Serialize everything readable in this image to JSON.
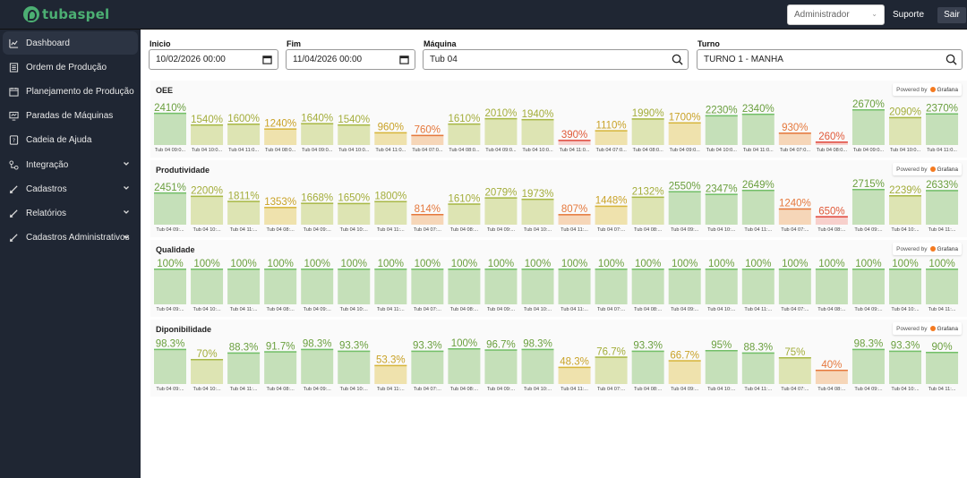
{
  "header": {
    "logo_text": "tubaspel",
    "role_value": "Administrador",
    "support_label": "Suporte",
    "logout_label": "Sair"
  },
  "sidebar": {
    "items": [
      {
        "label": "Dashboard",
        "icon": "chart-line-icon",
        "active": true,
        "expandable": false
      },
      {
        "label": "Ordem de Produção",
        "icon": "document-list-icon",
        "active": false,
        "expandable": false
      },
      {
        "label": "Planejamento de Produção",
        "icon": "calendar-icon",
        "active": false,
        "expandable": false
      },
      {
        "label": "Paradas de Máquinas",
        "icon": "monitor-icon",
        "active": false,
        "expandable": false
      },
      {
        "label": "Cadeia de Ajuda",
        "icon": "help-doc-icon",
        "active": false,
        "expandable": false
      },
      {
        "label": "Integração",
        "icon": "integration-icon",
        "active": false,
        "expandable": true
      },
      {
        "label": "Cadastros",
        "icon": "pencil-icon",
        "active": false,
        "expandable": true
      },
      {
        "label": "Relatórios",
        "icon": "pencil-icon",
        "active": false,
        "expandable": true
      },
      {
        "label": "Cadastros Administrativos",
        "icon": "pencil-icon",
        "active": false,
        "expandable": true
      }
    ]
  },
  "filters": {
    "start": {
      "label": "Inicio",
      "value": "10/02/2026 00:00"
    },
    "end": {
      "label": "Fim",
      "value": "11/04/2026 00:00"
    },
    "machine": {
      "label": "Máquina",
      "value": "Tub 04"
    },
    "shift": {
      "label": "Turno",
      "value": "TURNO 1 - MANHA"
    }
  },
  "powered_by": {
    "prefix": "Powered by",
    "brand": "Grafana"
  },
  "colors": {
    "green_fill": "#c5e0b9",
    "green_line": "#73bf69",
    "green_text": "#6a9f3e",
    "yellowgreen_fill": "#dde4b3",
    "yellowgreen_line": "#a8b846",
    "yellowgreen_text": "#a3ad3a",
    "yellow_fill": "#efe2ad",
    "yellow_line": "#d7b53c",
    "yellow_text": "#c9a227",
    "orange_fill": "#f6d6b8",
    "orange_line": "#e5783c",
    "orange_text": "#e5783c",
    "red_fill": "#f7d0cc",
    "red_line": "#e0463a",
    "red_text": "#e05a3a"
  },
  "chart_data": [
    {
      "type": "bar",
      "title": "OEE",
      "categories": [
        "Tub 04 09:0...",
        "Tub 04 10:0...",
        "Tub 04 11:0...",
        "Tub 04 08:0...",
        "Tub 04 09:0...",
        "Tub 04 10:0...",
        "Tub 04 11:0...",
        "Tub 04 07:0...",
        "Tub 04 08:0...",
        "Tub 04 09:0...",
        "Tub 04 10:0...",
        "Tub 04 11:0...",
        "Tub 04 07:0...",
        "Tub 04 08:0...",
        "Tub 04 09:0...",
        "Tub 04 10:0...",
        "Tub 04 11:0...",
        "Tub 04 07:0...",
        "Tub 04 08:0...",
        "Tub 04 09:0...",
        "Tub 04 10:0...",
        "Tub 04 11:0..."
      ],
      "values": [
        2410,
        1540,
        1600,
        1240,
        1640,
        1540,
        960,
        760,
        1610,
        2010,
        1940,
        390,
        1110,
        1990,
        1700,
        2230,
        2340,
        930,
        260,
        2670,
        2090,
        2370
      ],
      "labels": [
        "2410%",
        "1540%",
        "1600%",
        "1240%",
        "1640%",
        "1540%",
        "960%",
        "760%",
        "1610%",
        "2010%",
        "1940%",
        "390%",
        "1110%",
        "1990%",
        "1700%",
        "2230%",
        "2340%",
        "930%",
        "260%",
        "2670%",
        "2090%",
        "2370%"
      ],
      "colors": [
        "green",
        "yellowgreen",
        "yellowgreen",
        "yellow",
        "yellowgreen",
        "yellowgreen",
        "yellow",
        "orange",
        "yellowgreen",
        "yellowgreen",
        "yellowgreen",
        "red",
        "yellow",
        "yellowgreen",
        "yellow",
        "green",
        "green",
        "orange",
        "red",
        "green",
        "yellowgreen",
        "green"
      ],
      "ylim": [
        0,
        2670
      ]
    },
    {
      "type": "bar",
      "title": "Produtividade",
      "categories": [
        "Tub 04 09:...",
        "Tub 04 10:...",
        "Tub 04 11:...",
        "Tub 04 08:...",
        "Tub 04 09:...",
        "Tub 04 10:...",
        "Tub 04 11:...",
        "Tub 04 07:...",
        "Tub 04 08:...",
        "Tub 04 09:...",
        "Tub 04 10:...",
        "Tub 04 11:...",
        "Tub 04 07:...",
        "Tub 04 08:...",
        "Tub 04 09:...",
        "Tub 04 10:...",
        "Tub 04 11:...",
        "Tub 04 07:...",
        "Tub 04 08:...",
        "Tub 04 09:...",
        "Tub 04 10:...",
        "Tub 04 11:..."
      ],
      "values": [
        2451,
        2200,
        1811,
        1353,
        1668,
        1650,
        1800,
        814,
        1610,
        2079,
        1973,
        807,
        1448,
        2132,
        2550,
        2347,
        2649,
        1240,
        650,
        2715,
        2239,
        2633
      ],
      "labels": [
        "2451%",
        "2200%",
        "1811%",
        "1353%",
        "1668%",
        "1650%",
        "1800%",
        "814%",
        "1610%",
        "2079%",
        "1973%",
        "807%",
        "1448%",
        "2132%",
        "2550%",
        "2347%",
        "2649%",
        "1240%",
        "650%",
        "2715%",
        "2239%",
        "2633%"
      ],
      "colors": [
        "green",
        "yellowgreen",
        "yellowgreen",
        "yellow",
        "yellowgreen",
        "yellowgreen",
        "yellowgreen",
        "orange",
        "yellowgreen",
        "yellowgreen",
        "yellowgreen",
        "orange",
        "yellow",
        "yellowgreen",
        "green",
        "green",
        "green",
        "orange",
        "red",
        "green",
        "yellowgreen",
        "green"
      ],
      "ylim": [
        0,
        2715
      ]
    },
    {
      "type": "bar",
      "title": "Qualidade",
      "categories": [
        "Tub 04 09:...",
        "Tub 04 10:...",
        "Tub 04 11:...",
        "Tub 04 08:...",
        "Tub 04 09:...",
        "Tub 04 10:...",
        "Tub 04 11:...",
        "Tub 04 07:...",
        "Tub 04 08:...",
        "Tub 04 09:...",
        "Tub 04 10:...",
        "Tub 04 11:...",
        "Tub 04 07:...",
        "Tub 04 08:...",
        "Tub 04 09:...",
        "Tub 04 10:...",
        "Tub 04 11:...",
        "Tub 04 07:...",
        "Tub 04 08:...",
        "Tub 04 09:...",
        "Tub 04 10:...",
        "Tub 04 11:..."
      ],
      "values": [
        100,
        100,
        100,
        100,
        100,
        100,
        100,
        100,
        100,
        100,
        100,
        100,
        100,
        100,
        100,
        100,
        100,
        100,
        100,
        100,
        100,
        100
      ],
      "labels": [
        "100%",
        "100%",
        "100%",
        "100%",
        "100%",
        "100%",
        "100%",
        "100%",
        "100%",
        "100%",
        "100%",
        "100%",
        "100%",
        "100%",
        "100%",
        "100%",
        "100%",
        "100%",
        "100%",
        "100%",
        "100%",
        "100%"
      ],
      "colors": [
        "green",
        "green",
        "green",
        "green",
        "green",
        "green",
        "green",
        "green",
        "green",
        "green",
        "green",
        "green",
        "green",
        "green",
        "green",
        "green",
        "green",
        "green",
        "green",
        "green",
        "green",
        "green"
      ],
      "ylim": [
        0,
        100
      ]
    },
    {
      "type": "bar",
      "title": "Diponibilidade",
      "categories": [
        "Tub 04 09:...",
        "Tub 04 10:...",
        "Tub 04 11:...",
        "Tub 04 08:...",
        "Tub 04 09:...",
        "Tub 04 10:...",
        "Tub 04 11:...",
        "Tub 04 07:...",
        "Tub 04 08:...",
        "Tub 04 09:...",
        "Tub 04 10:...",
        "Tub 04 11:...",
        "Tub 04 07:...",
        "Tub 04 08:...",
        "Tub 04 09:...",
        "Tub 04 10:...",
        "Tub 04 11:...",
        "Tub 04 07:...",
        "Tub 04 08:...",
        "Tub 04 09:...",
        "Tub 04 10:...",
        "Tub 04 11:..."
      ],
      "values": [
        98.3,
        70,
        88.3,
        91.7,
        98.3,
        93.3,
        53.3,
        93.3,
        100,
        96.7,
        98.3,
        48.3,
        76.7,
        93.3,
        66.7,
        95,
        88.3,
        75,
        40,
        98.3,
        93.3,
        90
      ],
      "labels": [
        "98.3%",
        "70%",
        "88.3%",
        "91.7%",
        "98.3%",
        "93.3%",
        "53.3%",
        "93.3%",
        "100%",
        "96.7%",
        "98.3%",
        "48.3%",
        "76.7%",
        "93.3%",
        "66.7%",
        "95%",
        "88.3%",
        "75%",
        "40%",
        "98.3%",
        "93.3%",
        "90%"
      ],
      "colors": [
        "green",
        "yellowgreen",
        "green",
        "green",
        "green",
        "green",
        "yellow",
        "green",
        "green",
        "green",
        "green",
        "yellow",
        "yellowgreen",
        "green",
        "yellow",
        "green",
        "green",
        "yellowgreen",
        "orange",
        "green",
        "green",
        "green"
      ],
      "ylim": [
        0,
        100
      ]
    }
  ]
}
